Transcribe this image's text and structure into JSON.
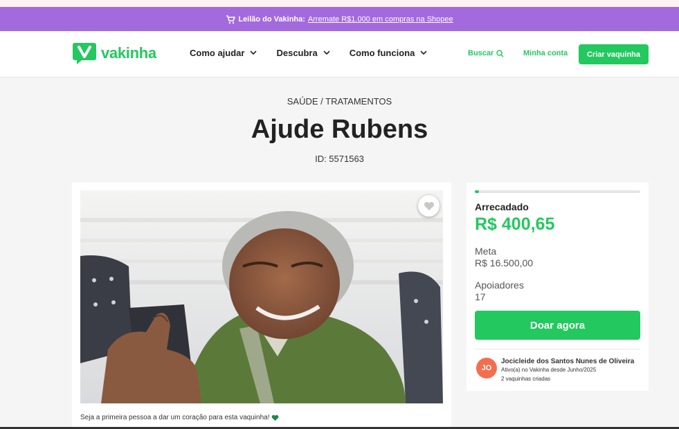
{
  "promo": {
    "bold": "Leilão do Vakinha:",
    "link": "Arremate R$1.000 em compras na Shopee",
    "icon": "cart-icon"
  },
  "header": {
    "logo": "vakinha",
    "nav": [
      {
        "label": "Como ajudar"
      },
      {
        "label": "Descubra"
      },
      {
        "label": "Como funciona"
      }
    ],
    "search_label": "Buscar",
    "account_label": "Minha conta",
    "create_label": "Criar vaquinha"
  },
  "campaign": {
    "category": "SAÚDE / TRATAMENTOS",
    "title": "Ajude Rubens",
    "id_text": "ID: 5571563",
    "first_heart_text": "Seja a primeira pessoa a dar um coração para esta vaquinha!"
  },
  "stats": {
    "raised_label": "Arrecadado",
    "raised_value": "R$ 400,65",
    "goal_label": "Meta",
    "goal_value": "R$ 16.500,00",
    "supporters_label": "Apoiadores",
    "supporters_value": "17",
    "progress_percent": 2.4,
    "donate_label": "Doar agora"
  },
  "creator": {
    "initials": "JO",
    "name": "Jocicleide dos Santos Nunes de Oliveira",
    "since": "Ativo(a) no Vakinha desde Junho/2025",
    "count": "2 vaquinhas criadas"
  },
  "colors": {
    "brand": "#23c85f",
    "promo_bg": "#a36add",
    "avatar_bg": "#f26e4f",
    "page_bg": "#f5f5f5"
  }
}
